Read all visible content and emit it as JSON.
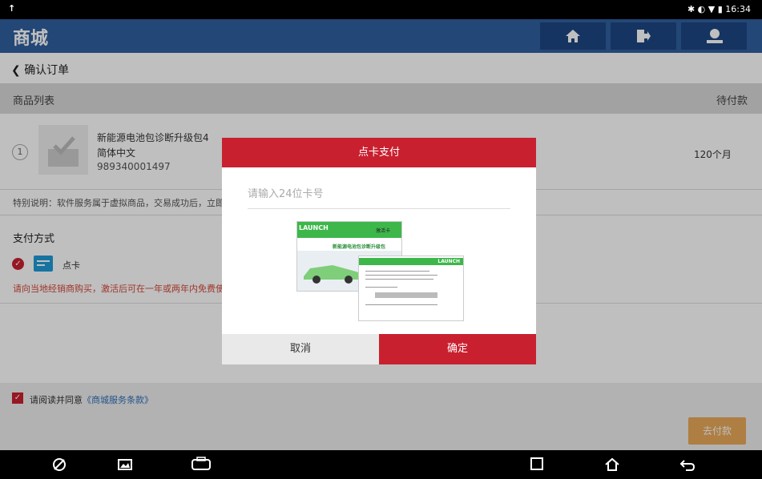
{
  "status_bar": {
    "left_icon": "upload-icon",
    "time": "16:34",
    "icons": [
      "bluetooth-icon",
      "vibrate-icon",
      "wifi-icon",
      "battery-icon"
    ]
  },
  "header": {
    "title": "商城",
    "buttons": [
      "home-icon",
      "exit-icon",
      "user-icon"
    ]
  },
  "sub_header": {
    "back_label": "确认订单"
  },
  "product_section": {
    "title": "商品列表",
    "status": "待付款"
  },
  "product": {
    "index": "1",
    "name": "新能源电池包诊断升级包4",
    "language": "简体中文",
    "sku": "989340001497",
    "duration": "120个月"
  },
  "notice": "特别说明：软件服务属于虚拟商品，交易成功后，立即",
  "payment": {
    "title": "支付方式",
    "method": "点卡",
    "hint": "请向当地经销商购买，激活后可在一年或两年内免费使"
  },
  "agreement": {
    "prefix": "请阅读并同意",
    "link": "《商城服务条款》"
  },
  "pay_button": "去付款",
  "dialog": {
    "title": "点卡支付",
    "placeholder": "请输入24位卡号",
    "cancel": "取消",
    "confirm": "确定",
    "card_front": {
      "brand": "LAUNCH",
      "tag": "激活卡",
      "product": "新能源电池包诊断升级包"
    },
    "card_back": {
      "brand": "LAUNCH"
    }
  },
  "colors": {
    "header_blue": "#2f5f9e",
    "accent_red": "#c9202f",
    "link_blue": "#2f6fb8",
    "pay_orange": "#e8a85a"
  }
}
